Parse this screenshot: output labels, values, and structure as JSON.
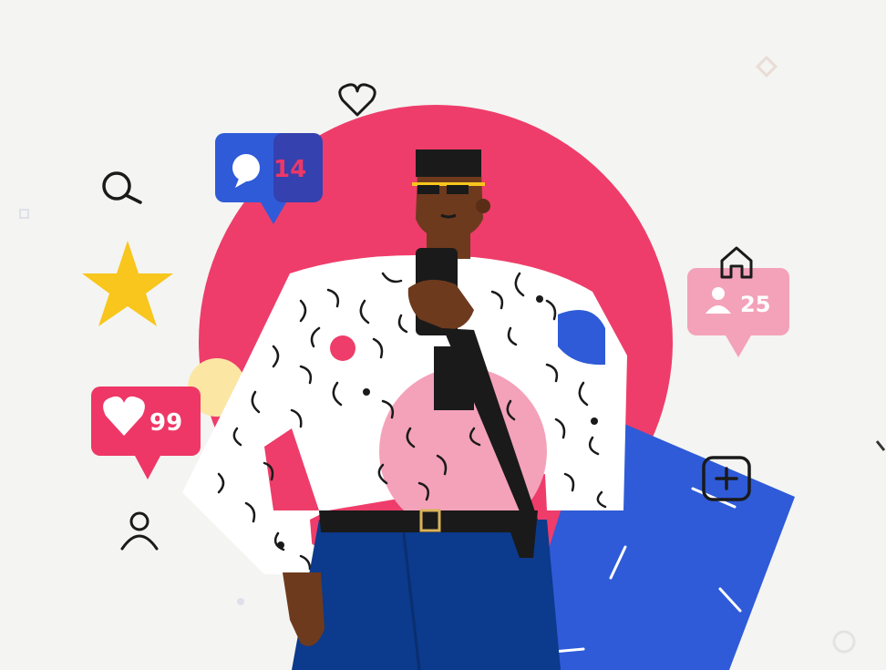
{
  "badges": {
    "comments": {
      "count": "14",
      "icon": "speech-bubble-icon",
      "color": "#2f5bd8"
    },
    "likes": {
      "count": "99",
      "icon": "heart-icon",
      "color": "#ee3766"
    },
    "followers": {
      "count": "25",
      "icon": "user-icon",
      "color": "#f3a2ba"
    }
  },
  "icons": [
    "heart-outline-icon",
    "search-icon",
    "star-icon",
    "home-icon",
    "add-icon",
    "user-outline-icon"
  ],
  "colors": {
    "background": "#f4f4f2",
    "circle": "#ee3d6a",
    "blue_card": "#2f5bd8",
    "star": "#f8c61c",
    "shirt_pink": "#f3a2ba",
    "jeans": "#0c3a8c",
    "skin": "#6e3a1e"
  }
}
